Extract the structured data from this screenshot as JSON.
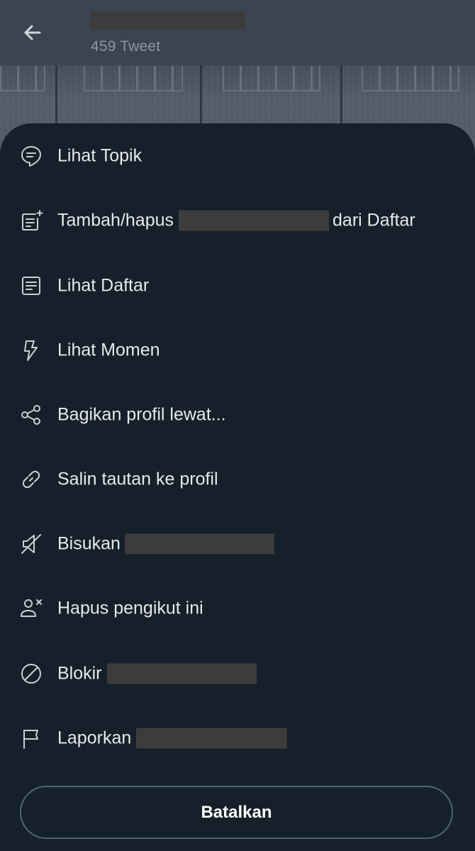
{
  "header": {
    "tweet_count": "459 Tweet"
  },
  "menu": [
    {
      "icon": "topic-icon",
      "label": "Lihat Topik"
    },
    {
      "icon": "list-add-icon",
      "label_before": "Tambah/hapus",
      "label_after": "dari Daftar"
    },
    {
      "icon": "list-icon",
      "label": "Lihat Daftar"
    },
    {
      "icon": "lightning-icon",
      "label": "Lihat Momen"
    },
    {
      "icon": "share-icon",
      "label": "Bagikan profil lewat..."
    },
    {
      "icon": "link-icon",
      "label": "Salin tautan ke profil"
    },
    {
      "icon": "mute-icon",
      "label": "Bisukan"
    },
    {
      "icon": "remove-follower-icon",
      "label": "Hapus pengikut ini"
    },
    {
      "icon": "block-icon",
      "label": "Blokir"
    },
    {
      "icon": "flag-icon",
      "label": "Laporkan"
    }
  ],
  "cancel_label": "Batalkan",
  "colors": {
    "sheet_background": "#15202b",
    "text": "#e7e9ea",
    "icon": "#c9cfd4",
    "button_border": "#536471",
    "redaction": "#3c3c3c"
  }
}
